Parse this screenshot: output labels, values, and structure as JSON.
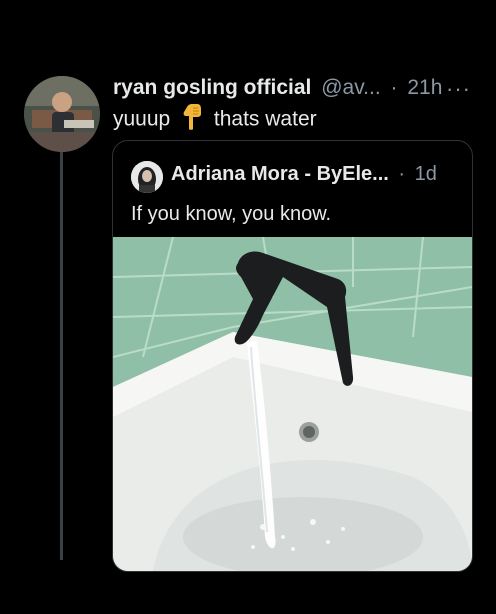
{
  "tweet": {
    "author_name": "ryan gosling official",
    "handle": "@av...",
    "time_sep": "·",
    "time": "21h",
    "more_label": "···",
    "text_before": "yuuup",
    "text_after": "thats water",
    "emoji": "pointing-down-hand"
  },
  "quoted_tweet": {
    "author_name": "Adriana Mora - ByEle...",
    "time_sep": "·",
    "time": "1d",
    "text": "If you know, you know.",
    "media": "photo of a black faucet running water into a white sink with teal tiles"
  },
  "colors": {
    "background": "#000000",
    "text": "#e7e9ea",
    "secondary": "#8b98a5",
    "border": "#2f3336",
    "tile": "#8fbfa6"
  }
}
